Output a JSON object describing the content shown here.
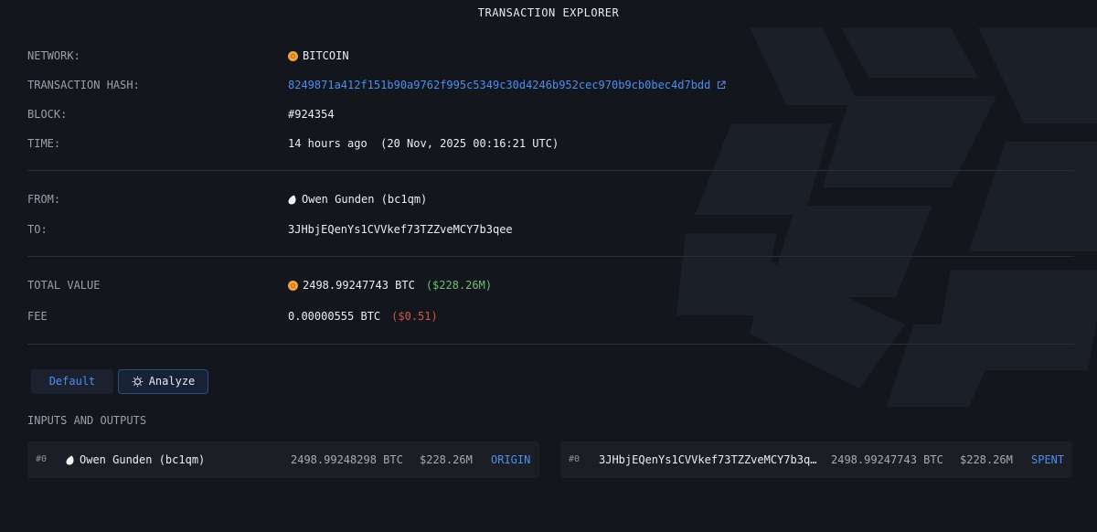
{
  "header": {
    "title": "TRANSACTION EXPLORER"
  },
  "details": {
    "network": {
      "label": "NETWORK:",
      "value": "BITCOIN",
      "icon": "bitcoin-coin-icon"
    },
    "hash": {
      "label": "TRANSACTION HASH:",
      "value": "8249871a412f151b90a9762f995c5349c30d4246b952cec970b9cb0bec4d7bdd",
      "icon": "external-link-icon"
    },
    "block": {
      "label": "BLOCK:",
      "value": "#924354"
    },
    "time": {
      "label": "TIME:",
      "value": "14 hours ago  (20 Nov, 2025 00:16:21 UTC)"
    },
    "from": {
      "label": "FROM:",
      "value": "Owen Gunden (bc1qm)",
      "icon": "droplet-icon"
    },
    "to": {
      "label": "TO:",
      "value": "3JHbjEQenYs1CVVkef73TZZveMCY7b3qee"
    },
    "total": {
      "label": "TOTAL VALUE",
      "value": "2498.99247743 BTC",
      "usd": "($228.26M)"
    },
    "fee": {
      "label": "FEE",
      "value": "0.00000555 BTC",
      "usd": "($0.51)"
    }
  },
  "tabs": [
    {
      "label": "Default"
    },
    {
      "label": "Analyze",
      "icon": "gear-icon"
    }
  ],
  "io": {
    "heading": "INPUTS AND OUTPUTS",
    "input": {
      "index": "#0",
      "address": "Owen Gunden (bc1qm)",
      "amount": "2498.99248298 BTC",
      "usd": "$228.26M",
      "status": "ORIGIN"
    },
    "output": {
      "index": "#0",
      "address": "3JHbjEQenYs1CVVkef73TZZveMCY7b3q…",
      "amount": "2498.99247743 BTC",
      "usd": "$228.26M",
      "status": "SPENT"
    }
  },
  "colors": {
    "background": "#13161c",
    "accent_blue": "#4c8ff0",
    "positive_green": "#6fbf73",
    "negative_red": "#d0574a",
    "bitcoin_orange": "#f2a33a"
  }
}
